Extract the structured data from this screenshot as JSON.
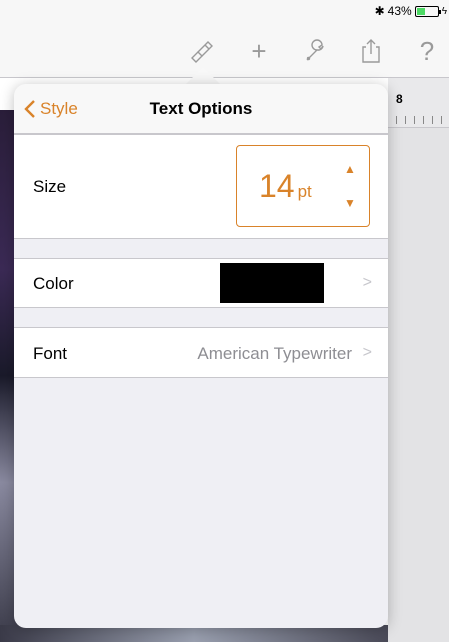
{
  "status_bar": {
    "bluetooth_icon": "bluetooth-icon",
    "battery_percent": "43%",
    "battery_level": 0.43,
    "charging_icon": "bolt-icon"
  },
  "toolbar": {
    "icons": [
      "paintbrush-icon",
      "plus-icon",
      "wrench-icon",
      "share-icon",
      "help-icon"
    ],
    "help_label": "?",
    "plus_label": "+"
  },
  "ruler": {
    "number": "8"
  },
  "popover": {
    "back_label": "Style",
    "title": "Text Options",
    "size": {
      "label": "Size",
      "value": "14",
      "unit": "pt"
    },
    "color": {
      "label": "Color",
      "swatch_color": "#000000"
    },
    "font": {
      "label": "Font",
      "value": "American Typewriter"
    }
  },
  "colors": {
    "accent": "#d9832a",
    "chevron": "#c7c7cc",
    "secondary_text": "#8e8e93"
  }
}
